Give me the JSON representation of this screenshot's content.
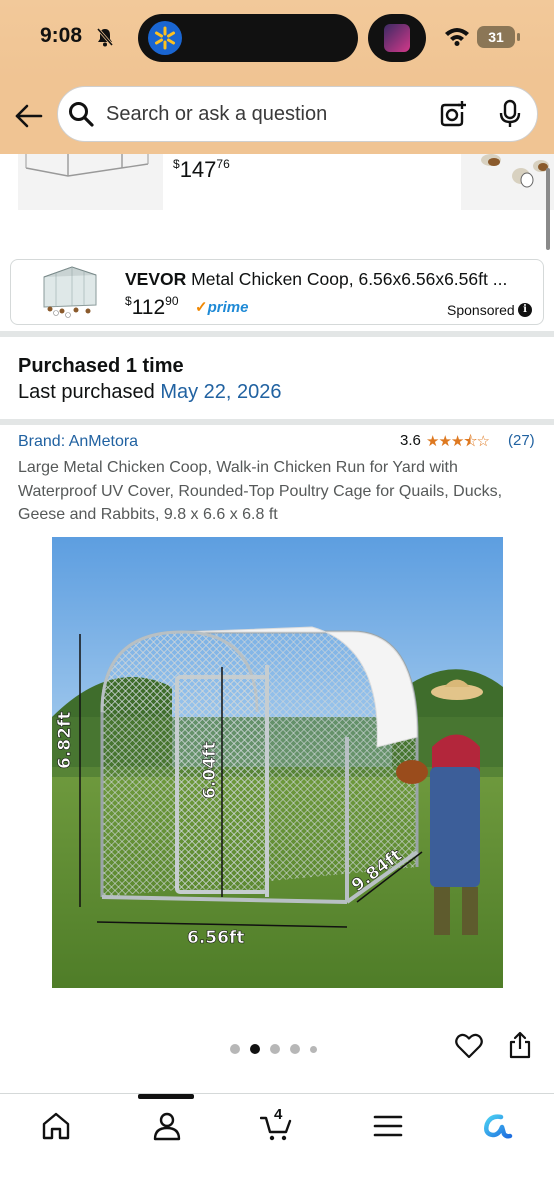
{
  "status_bar": {
    "time": "9:08",
    "battery": "31"
  },
  "search": {
    "placeholder": "Search or ask a question"
  },
  "top_item": {
    "price_whole": "147",
    "price_fraction": "76"
  },
  "sponsored": {
    "brand": "VEVOR",
    "title": "Metal Chicken Coop, 6.56x6.56x6.56ft ...",
    "price_whole": "112",
    "price_fraction": "90",
    "prime_label": "prime",
    "sponsored_label": "Sponsored"
  },
  "purchase_history": {
    "title": "Purchased 1 time",
    "last_label": "Last purchased",
    "last_date": "May 22, 2026"
  },
  "product": {
    "brand_link": "Brand: AnMetora",
    "rating": "3.6",
    "rating_value": 3.6,
    "rating_count": "(27)",
    "title": "Large Metal Chicken Coop, Walk-in Chicken Run for Yard with Waterproof UV Cover, Rounded-Top Poultry Cage for Quails, Ducks, Geese and Rabbits, 9.8 x 6.6 x 6.8 ft",
    "image_labels": {
      "height": "6.82ft",
      "door_height": "6.04ft",
      "width": "6.56ft",
      "depth": "9.84ft"
    }
  },
  "carousel": {
    "total": 5,
    "active_index": 1
  },
  "bottom_nav": {
    "cart_count": "4",
    "items": [
      "home-icon",
      "account-icon",
      "cart-icon",
      "menu-icon",
      "rufus-icon"
    ]
  },
  "colors": {
    "header_bg": "#f0c493",
    "link": "#2162a1",
    "star": "#de7921",
    "prime_blue": "#1f8ad6"
  }
}
